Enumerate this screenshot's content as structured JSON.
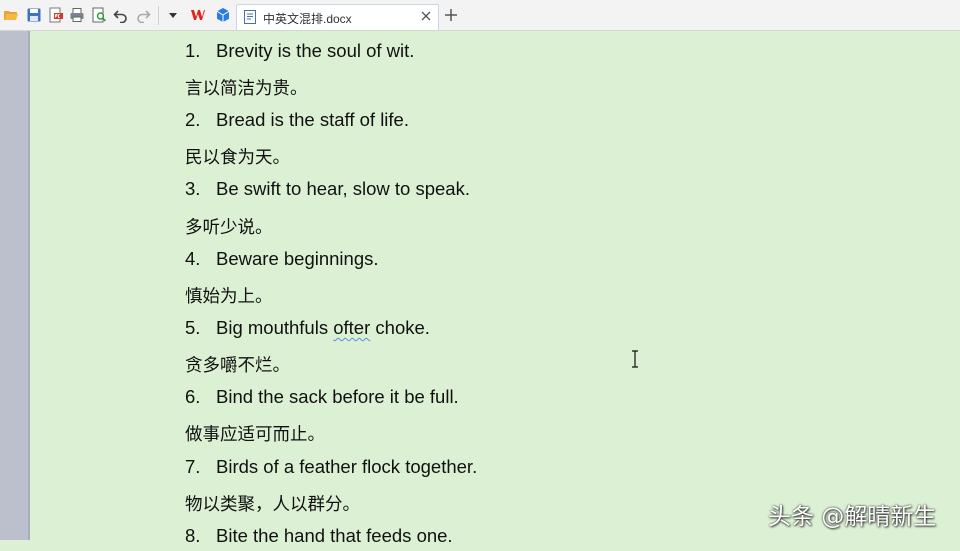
{
  "toolbar": {
    "icons": [
      "open-folder-icon",
      "save-icon",
      "export-pdf-icon",
      "print-icon",
      "print-preview-icon",
      "undo-icon",
      "redo-icon",
      "more-dropdown-icon",
      "wps-logo-icon",
      "cube-app-icon"
    ],
    "tab": {
      "title": "中英文混排.docx"
    }
  },
  "document": {
    "lines": [
      {
        "num": "1.",
        "text": "Brevity is the soul of wit."
      },
      {
        "text": "言以简洁为贵。"
      },
      {
        "num": "2.",
        "text": "Bread is the staff of life."
      },
      {
        "text": "民以食为天。"
      },
      {
        "num": "3.",
        "text": "Be swift to hear, slow to speak."
      },
      {
        "text": "多听少说。"
      },
      {
        "num": "4.",
        "text": "Beware beginnings."
      },
      {
        "text": "慎始为上。"
      },
      {
        "num": "5.",
        "text_before": "Big mouthfuls ",
        "text_flagged": "ofter",
        "text_after": " choke."
      },
      {
        "text": "贪多嚼不烂。"
      },
      {
        "num": "6.",
        "text": "Bind the sack before it be full."
      },
      {
        "text": "做事应适可而止。"
      },
      {
        "num": "7.",
        "text": "Birds of a feather flock together."
      },
      {
        "text": "物以类聚，人以群分。"
      },
      {
        "num": "8.",
        "text": "Bite the hand that feeds one."
      }
    ]
  },
  "watermark": "头条 @解晴新生",
  "colors": {
    "page_bg": "#dcf0d4",
    "toolbar_bg": "#f3f3f3",
    "strip": "#bcc0cc",
    "wps_red": "#e2231a",
    "accent_blue": "#2a7be4",
    "spell_squiggle": "#5b8de0"
  }
}
